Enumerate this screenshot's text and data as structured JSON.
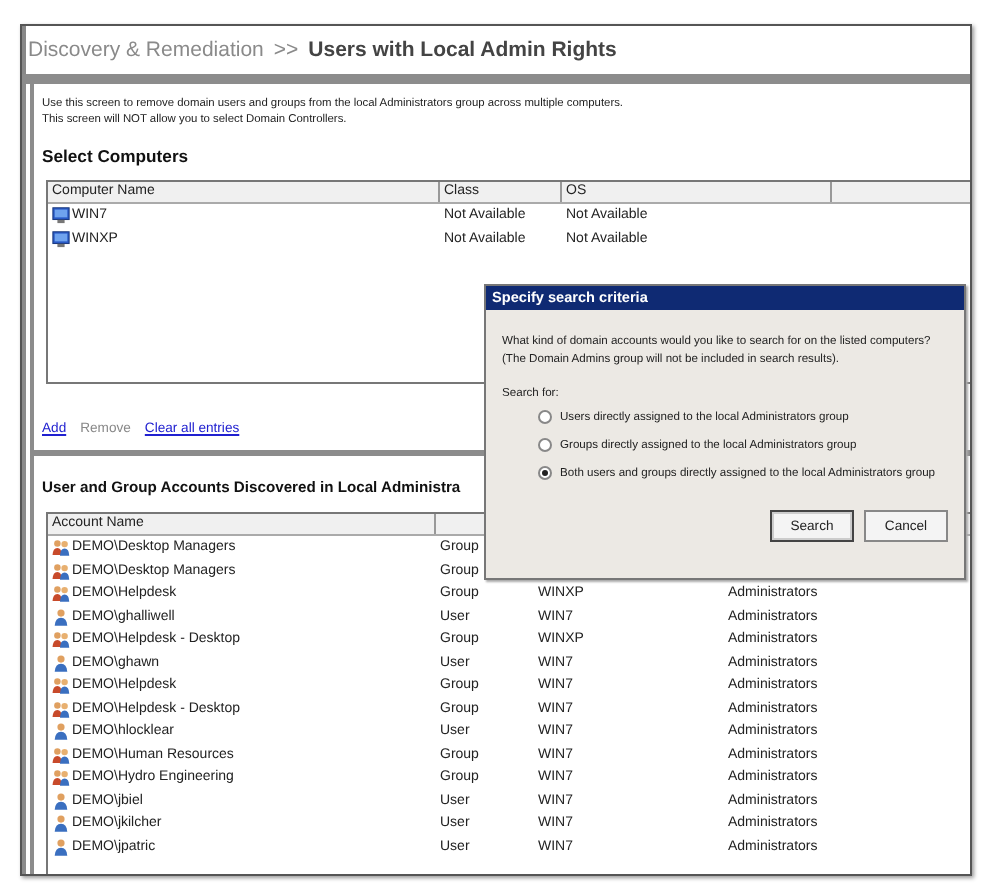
{
  "header": {
    "breadcrumb": "Discovery & Remediation",
    "separator": ">>",
    "title": "Users with Local Admin Rights"
  },
  "intro": [
    "Use this screen to remove domain users and groups from the local Administrators group across multiple computers.",
    "This screen will NOT allow you to select Domain Controllers."
  ],
  "computers": {
    "heading": "Select Computers",
    "columns": [
      "Computer Name",
      "Class",
      "OS"
    ],
    "rows": [
      [
        "WIN7",
        "Not Available",
        "Not Available"
      ],
      [
        "WINXP",
        "Not Available",
        "Not Available"
      ]
    ]
  },
  "links": [
    {
      "label": "Add",
      "disabled": false
    },
    {
      "label": "Remove",
      "disabled": true
    },
    {
      "label": "Clear all entries",
      "disabled": false
    }
  ],
  "accounts": {
    "heading": "User and Group Accounts Discovered in Local Administra",
    "columns": [
      "Account Name"
    ],
    "rows": [
      {
        "kind": "group",
        "cells": [
          "DEMO\\Desktop Managers",
          "Group"
        ]
      },
      {
        "kind": "group",
        "cells": [
          "DEMO\\Desktop Managers",
          "Group"
        ]
      },
      {
        "kind": "group",
        "cells": [
          "DEMO\\Helpdesk",
          "Group",
          "WINXP",
          "Administrators"
        ]
      },
      {
        "kind": "user",
        "cells": [
          "DEMO\\ghalliwell",
          "User",
          "WIN7",
          "Administrators"
        ]
      },
      {
        "kind": "group",
        "cells": [
          "DEMO\\Helpdesk - Desktop",
          "Group",
          "WINXP",
          "Administrators"
        ]
      },
      {
        "kind": "user",
        "cells": [
          "DEMO\\ghawn",
          "User",
          "WIN7",
          "Administrators"
        ]
      },
      {
        "kind": "group",
        "cells": [
          "DEMO\\Helpdesk",
          "Group",
          "WIN7",
          "Administrators"
        ]
      },
      {
        "kind": "group",
        "cells": [
          "DEMO\\Helpdesk - Desktop",
          "Group",
          "WIN7",
          "Administrators"
        ]
      },
      {
        "kind": "user",
        "cells": [
          "DEMO\\hlocklear",
          "User",
          "WIN7",
          "Administrators"
        ]
      },
      {
        "kind": "group",
        "cells": [
          "DEMO\\Human Resources",
          "Group",
          "WIN7",
          "Administrators"
        ]
      },
      {
        "kind": "group",
        "cells": [
          "DEMO\\Hydro Engineering",
          "Group",
          "WIN7",
          "Administrators"
        ]
      },
      {
        "kind": "user",
        "cells": [
          "DEMO\\jbiel",
          "User",
          "WIN7",
          "Administrators"
        ]
      },
      {
        "kind": "user",
        "cells": [
          "DEMO\\jkilcher",
          "User",
          "WIN7",
          "Administrators"
        ]
      },
      {
        "kind": "user",
        "cells": [
          "DEMO\\jpatric",
          "User",
          "WIN7",
          "Administrators"
        ]
      }
    ]
  },
  "dialog": {
    "title": "Specify search criteria",
    "message": [
      "What kind of domain accounts would you like to search for on the listed computers?",
      "(The Domain Admins group will not be included in search results)."
    ],
    "label": "Search for:",
    "options": [
      {
        "label": "Users directly assigned to the local Administrators group",
        "selected": false
      },
      {
        "label": "Groups directly assigned to the local Administrators group",
        "selected": false
      },
      {
        "label": "Both users and groups directly assigned to the local Administrators group",
        "selected": true
      }
    ],
    "buttons": [
      "Search",
      "Cancel"
    ]
  }
}
